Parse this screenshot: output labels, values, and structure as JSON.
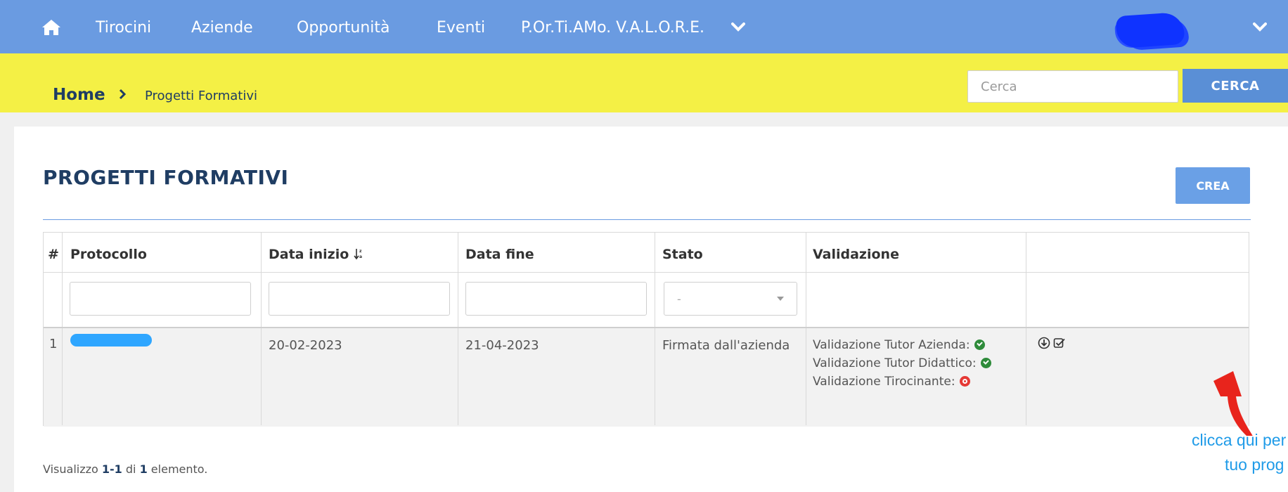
{
  "nav": {
    "items": [
      "Tirocini",
      "Aziende",
      "Opportunità",
      "Eventi",
      "P.Or.Ti.AMo. V.A.L.O.R.E."
    ],
    "home_icon": "home-icon",
    "user_menu_icon": "chevron-down-icon"
  },
  "breadcrumb": {
    "home": "Home",
    "current": "Progetti Formativi"
  },
  "search": {
    "placeholder": "Cerca",
    "button": "CERCA"
  },
  "page": {
    "title": "PROGETTI FORMATIVI",
    "create_button": "CREA"
  },
  "table": {
    "columns": [
      "#",
      "Protocollo",
      "Data inizio",
      "Data fine",
      "Stato",
      "Validazione"
    ],
    "sort_icon": "sort-asc-icon",
    "stato_filter_selected": "-",
    "rows": [
      {
        "index": "1",
        "protocollo": "",
        "data_inizio": "20-02-2023",
        "data_fine": "21-04-2023",
        "stato": "Firmata dall'azienda",
        "validazione": [
          {
            "label": "Validazione Tutor Azienda:",
            "status": "ok"
          },
          {
            "label": "Validazione Tutor Didattico:",
            "status": "ok"
          },
          {
            "label": "Validazione Tirocinante:",
            "status": "ko"
          }
        ],
        "actions": [
          "download-icon",
          "check-square-icon"
        ]
      }
    ]
  },
  "summary": {
    "prefix": "Visualizzo ",
    "range": "1-1",
    "middle": " di ",
    "total": "1",
    "suffix": " elemento."
  },
  "annotation": {
    "line1": "clicca qui per",
    "line2": "tuo prog"
  },
  "colors": {
    "nav": "#6a9be1",
    "breadcrumb_bar": "#f4f045",
    "primary_button": "#5a8fd6",
    "ok": "#2e8b3a",
    "ko": "#e53935",
    "arrow": "#e8241c",
    "annotation": "#1f9be8"
  }
}
